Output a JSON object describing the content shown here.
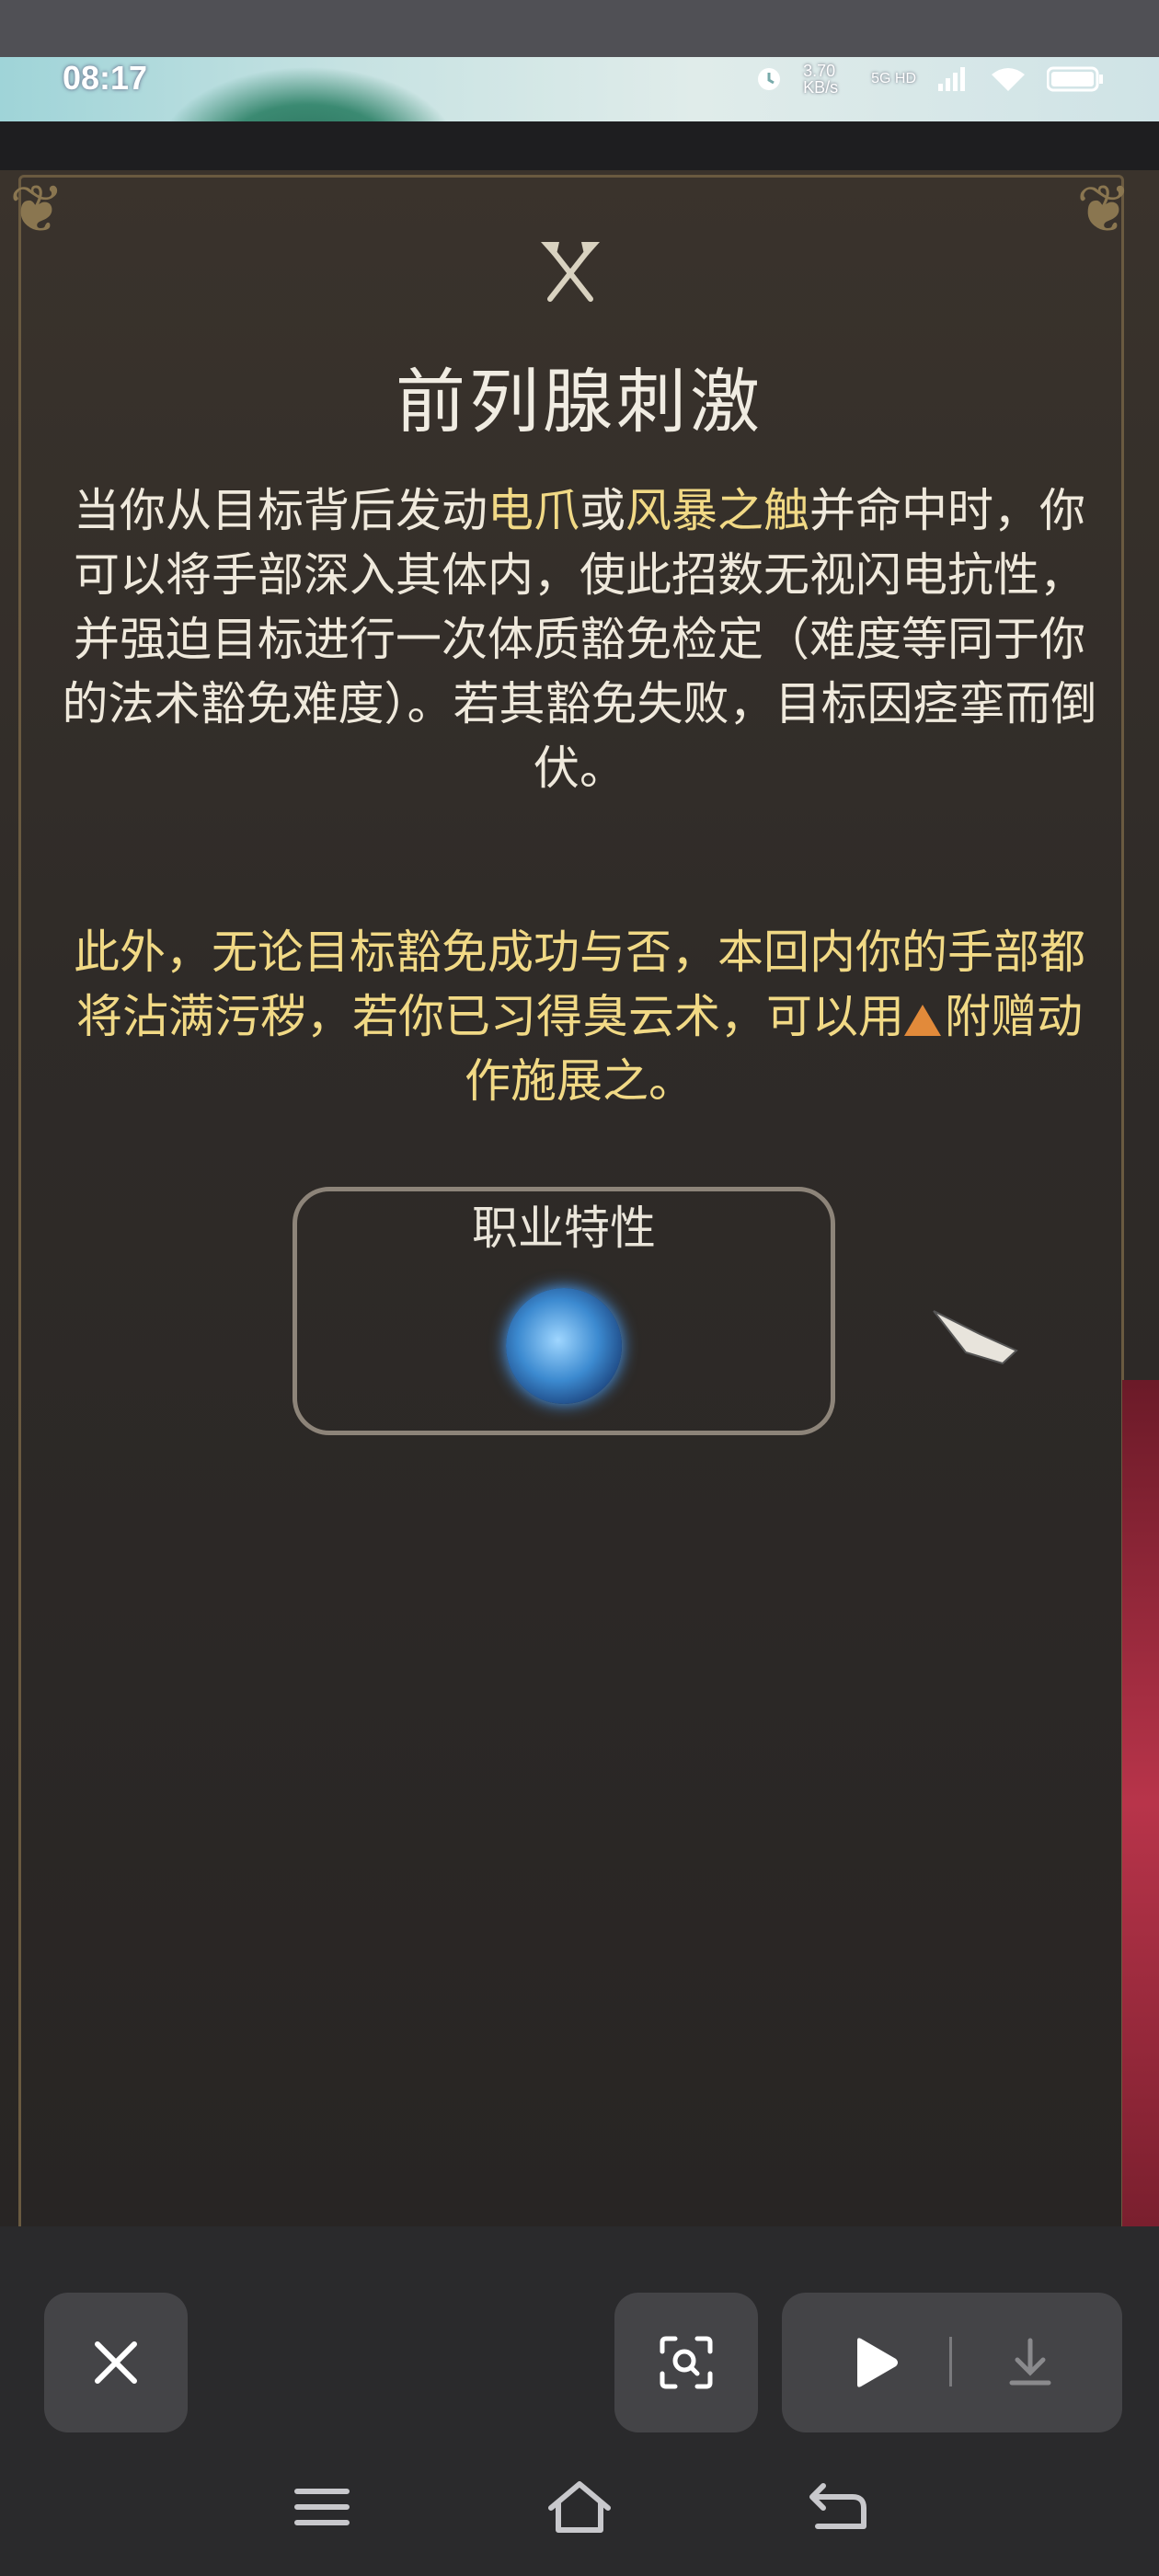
{
  "status_bar": {
    "time": "08:17",
    "net_speed": "3.70 KB/s",
    "signal_label": "5G HD"
  },
  "card": {
    "title": "前列腺刺激",
    "desc1": {
      "a": "当你从目标背后发动",
      "h1": "电爪",
      "b": "或",
      "h2": "风暴之触",
      "c": "并命中时，你可以将手部深入其体内，使此招数无视闪电抗性，并强迫目标进行一次体质豁免检定（难度等同于你的法术豁免难度）。若其豁免失败，目标因痉挛而倒伏。"
    },
    "desc2": {
      "a": "此外，无论目标豁免成功与否，本回内你的手部都将沾满污秽，若你已习得臭云术，可以用",
      "h": "附赠动作",
      "b": "施展之。"
    },
    "feature_label": "职业特性"
  },
  "icons": {
    "crest": "crossed-axes-icon",
    "feature": "class-feature-rune-icon",
    "cursor": "gauntlet-cursor-icon",
    "close": "close-icon",
    "scan": "scan-lens-icon",
    "play": "play-icon",
    "download": "download-icon",
    "menu": "menu-icon",
    "home": "home-icon",
    "back": "back-icon"
  },
  "colors": {
    "highlight": "#f1d985",
    "body_text": "#efe9dc",
    "panel_bg": "#2f2b28"
  }
}
